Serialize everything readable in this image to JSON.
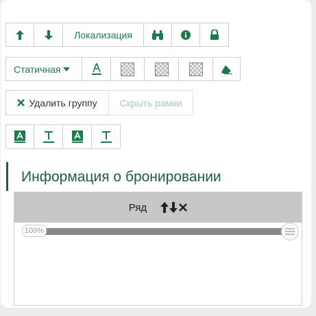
{
  "toolbar1": {
    "localization_label": "Локализация",
    "icons": [
      "arrow-up-icon",
      "arrow-down-icon",
      "binoculars-icon",
      "info-icon",
      "lock-icon"
    ]
  },
  "toolbar2": {
    "position_select": "Статичная",
    "icons": [
      "text-color-icon",
      "transparent-swatch-icon",
      "eraser-icon"
    ]
  },
  "toolbar3": {
    "delete_group_label": "Удалить группу",
    "hide_frames_label": "Скрыть рамки"
  },
  "toolbar4": {
    "icons": [
      "text-style-icon",
      "text-underline-icon"
    ]
  },
  "section": {
    "title": "Информация о бронировании",
    "row_label": "Ряд",
    "slider_value": "100%",
    "slider_fraction": 1.0
  },
  "colors": {
    "accent": "#1b7a4a",
    "heading": "#1d5e3c",
    "row_bar": "#c6c6c6"
  }
}
